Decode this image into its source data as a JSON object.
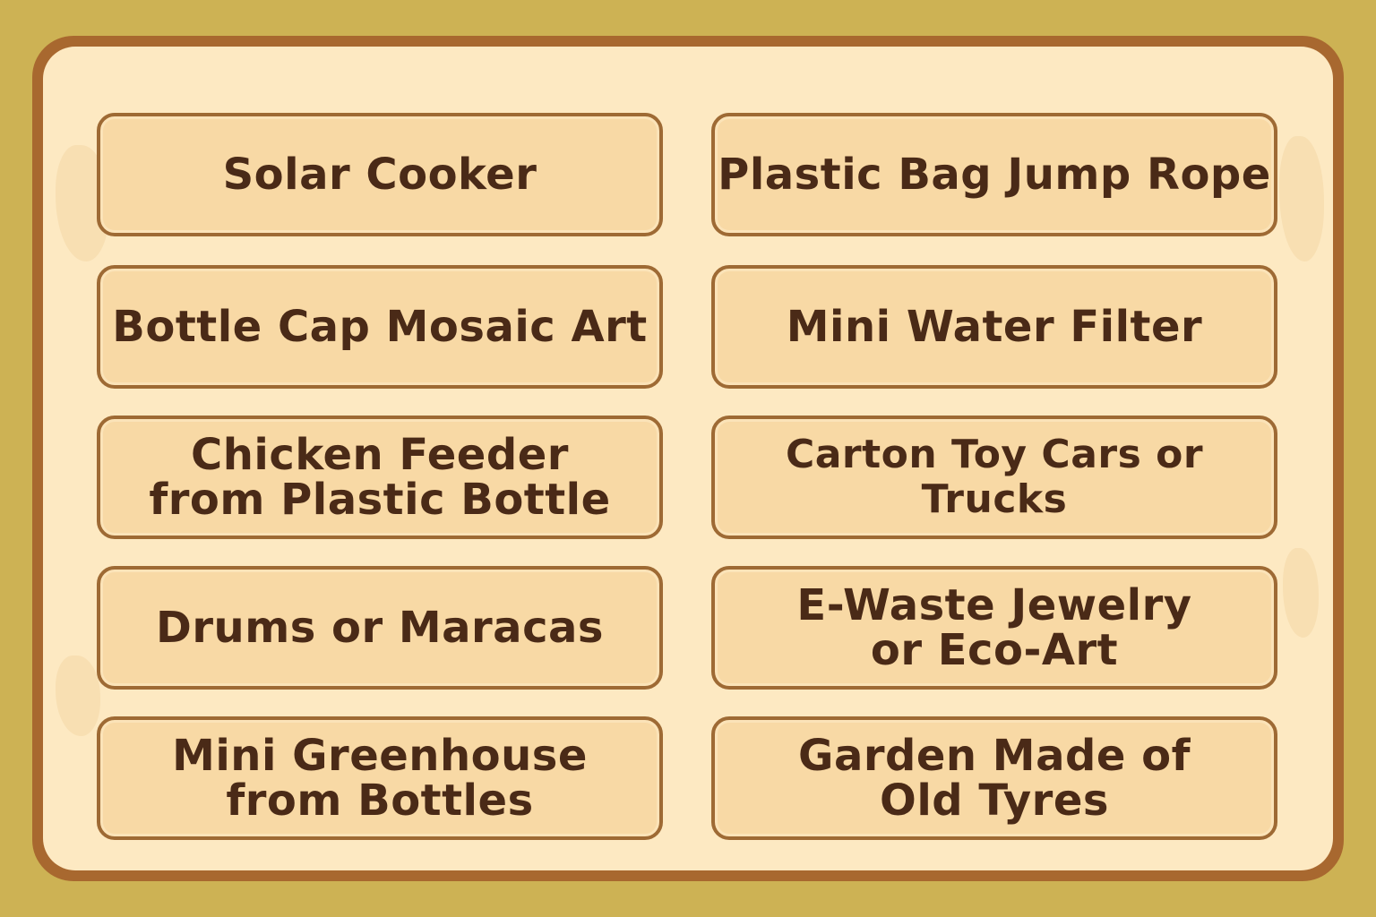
{
  "colors": {
    "background": "#cdb254",
    "frame": "#a8682f",
    "panel": "#fde9c2",
    "card": "#f8d9a5",
    "card_border": "#9e6a34",
    "text": "#4a2a17"
  },
  "cards": [
    {
      "label": "Solar Cooker"
    },
    {
      "label": "Plastic Bag Jump Rope"
    },
    {
      "label": "Bottle Cap Mosaic Art"
    },
    {
      "label": "Mini Water Filter"
    },
    {
      "label": "Chicken Feeder\nfrom Plastic Bottle"
    },
    {
      "label": "Carton Toy Cars or Trucks"
    },
    {
      "label": "Drums or Maracas"
    },
    {
      "label": "E-Waste Jewelry\nor Eco-Art"
    },
    {
      "label": "Mini Greenhouse\nfrom Bottles"
    },
    {
      "label": "Garden Made of\nOld Tyres"
    }
  ]
}
